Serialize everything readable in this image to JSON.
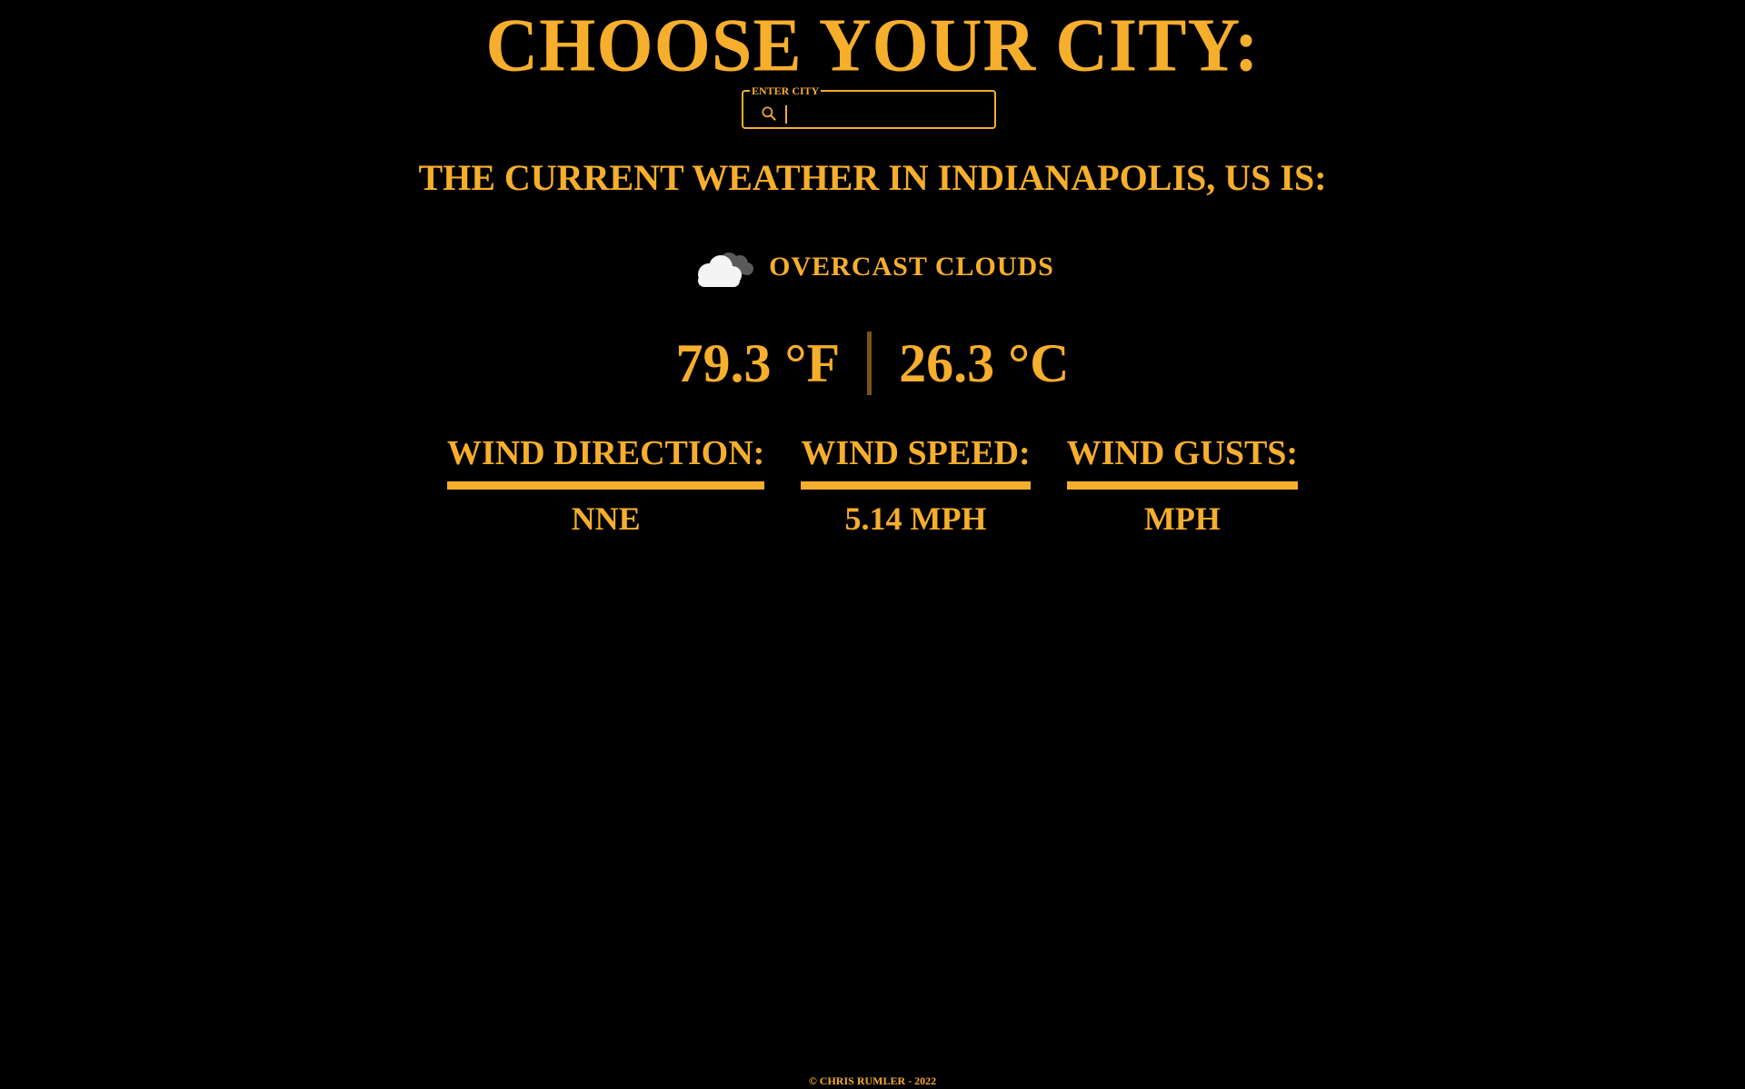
{
  "header": {
    "title": "CHOOSE YOUR CITY:"
  },
  "search": {
    "legend": "ENTER CITY",
    "value": "",
    "placeholder": ""
  },
  "weather": {
    "heading": "THE CURRENT WEATHER IN INDIANAPOLIS, US IS:",
    "condition": "OVERCAST CLOUDS",
    "condition_icon": "overcast-clouds-icon",
    "temp_f": "79.3 °F",
    "temp_c": "26.3 °C"
  },
  "wind": {
    "direction_label": "WIND DIRECTION:",
    "direction_value": "NNE",
    "speed_label": "WIND SPEED:",
    "speed_value": "5.14 MPH",
    "gusts_label": "WIND GUSTS:",
    "gusts_value": "MPH"
  },
  "footer": {
    "text": "© CHRIS RUMLER   - 2022"
  },
  "colors": {
    "accent": "#f6ae2d",
    "background": "#000000",
    "divider": "#7a5616"
  }
}
